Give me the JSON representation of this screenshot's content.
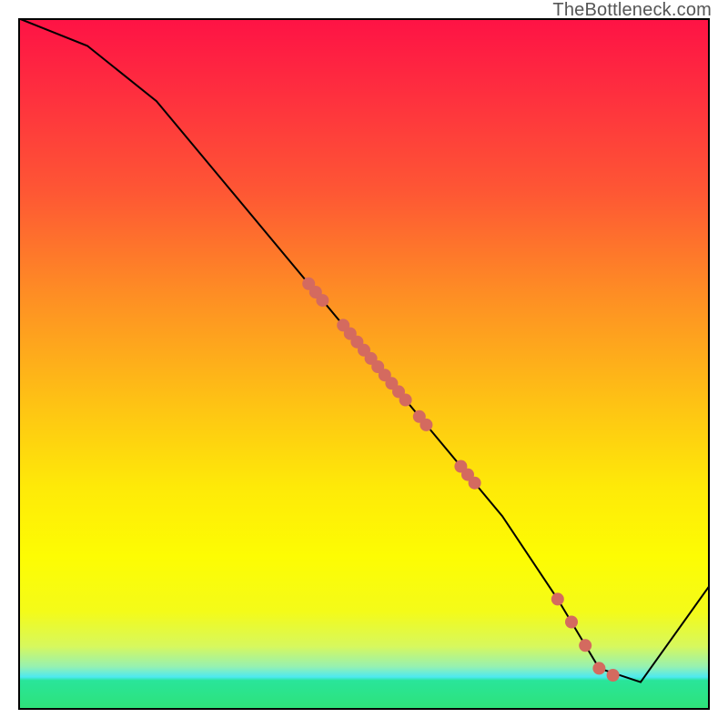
{
  "watermark": "TheBottleneck.com",
  "chart_data": {
    "type": "line",
    "title": "",
    "xlabel": "",
    "ylabel": "",
    "xlim": [
      0,
      100
    ],
    "ylim": [
      0,
      100
    ],
    "line": {
      "x": [
        0,
        10,
        20,
        30,
        40,
        50,
        60,
        70,
        78,
        84,
        90,
        100
      ],
      "y": [
        100,
        96,
        88,
        76,
        64,
        52,
        40,
        28,
        16,
        6,
        4,
        18
      ]
    },
    "points": {
      "x": [
        42,
        43,
        44,
        47,
        48,
        49,
        50,
        51,
        52,
        53,
        54,
        55,
        56,
        58,
        59,
        64,
        65,
        66,
        78,
        80,
        82,
        84,
        86
      ],
      "y": [
        61.6,
        60.4,
        59.2,
        55.6,
        54.4,
        53.2,
        52.0,
        50.8,
        49.6,
        48.4,
        47.2,
        46.0,
        44.8,
        42.4,
        41.2,
        35.2,
        34.0,
        32.8,
        16.0,
        12.7,
        9.3,
        6.0,
        5.0
      ]
    },
    "point_color": "#d46a5f",
    "line_color": "#000000"
  }
}
